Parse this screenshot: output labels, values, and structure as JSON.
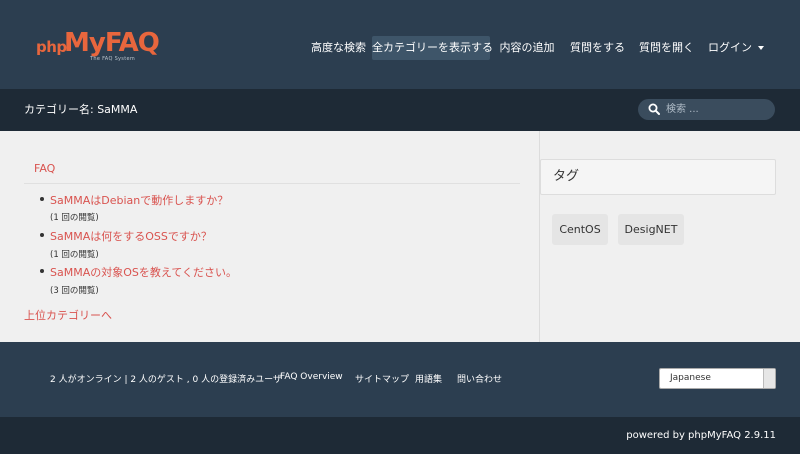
{
  "header": {
    "logo_php": "php",
    "logo_myfaq": "MyFAQ",
    "logo_tagline": "The FAQ System",
    "nav": [
      {
        "label": "高度な検索"
      },
      {
        "label": "全カテゴリーを表示する",
        "active": true
      },
      {
        "label": "内容の追加"
      },
      {
        "label": "質問をする"
      },
      {
        "label": "質問を開く"
      },
      {
        "label": "ログイン"
      }
    ]
  },
  "subbar": {
    "breadcrumb": "カテゴリー名: SaMMA",
    "search_placeholder": "検索 ..."
  },
  "main": {
    "faq_heading": "FAQ",
    "questions": [
      {
        "title": "SaMMAはDebianで動作しますか？",
        "views": "(1 回の閲覧)"
      },
      {
        "title": "SaMMAは何をするOSSですか？",
        "views": "(1 回の閲覧)"
      },
      {
        "title": "SaMMAの対象OSを教えてください。",
        "views": "(3 回の閲覧)"
      }
    ],
    "parent_link": "上位カテゴリーへ"
  },
  "sidebar": {
    "tags_heading": "タグ",
    "tags": [
      "CentOS",
      "DesigNET"
    ]
  },
  "footer": {
    "online": "2 人がオンライン | 2 人のゲスト , 0 人の登録済みユーザ",
    "links": [
      "FAQ Overview",
      "サイトマップ",
      "用語集",
      "問い合わせ"
    ],
    "language": "Japanese",
    "powered": "powered by phpMyFAQ 2.9.11"
  },
  "colors": {
    "header_bg": "#2c3e50",
    "dark_bar": "#1e2a36",
    "accent": "#d9534f",
    "logo": "#e8663d"
  },
  "icons": {
    "search": "search-icon",
    "login_dropdown": "caret-down-icon",
    "language_dropdown": "select-arrow-icon"
  }
}
